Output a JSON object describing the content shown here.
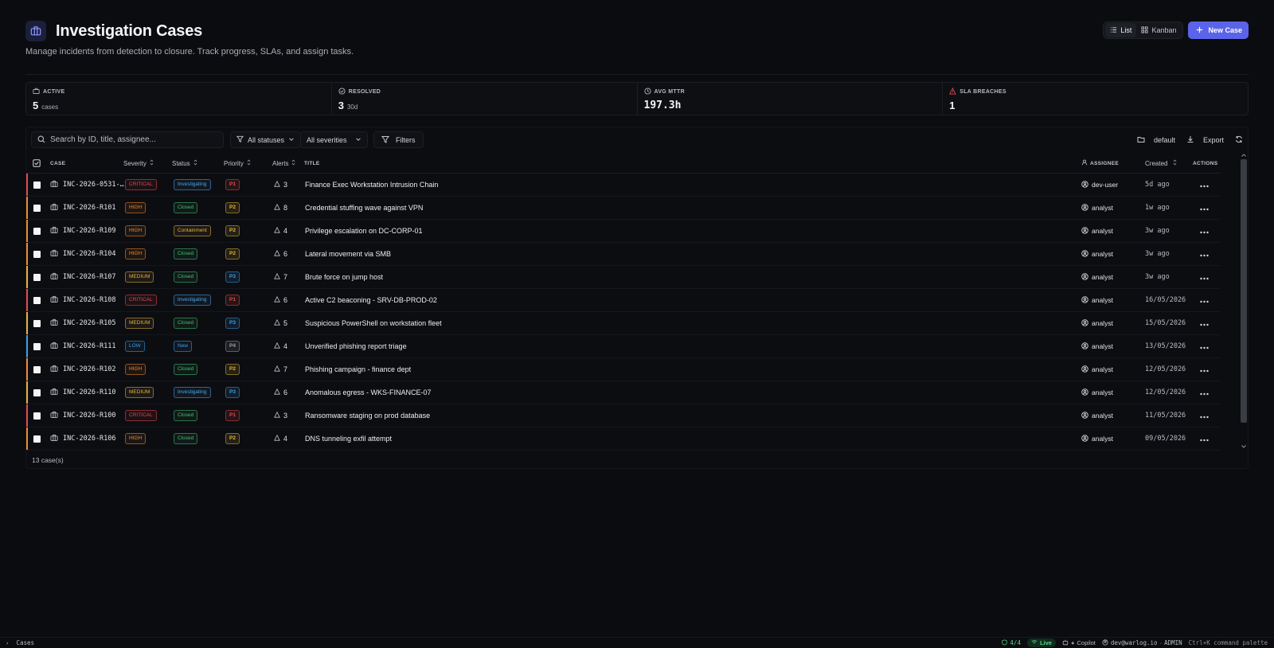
{
  "header": {
    "title": "Investigation Cases",
    "subtitle": "Manage incidents from detection to closure. Track progress, SLAs, and assign tasks.",
    "view_list": "List",
    "view_kanban": "Kanban",
    "new_case": "New Case"
  },
  "stats": [
    {
      "label": "ACTIVE",
      "value": "5",
      "unit": "cases"
    },
    {
      "label": "RESOLVED",
      "value": "3",
      "unit": "30d"
    },
    {
      "label": "AVG MTTR",
      "value": "197.3h",
      "unit": ""
    },
    {
      "label": "SLA BREACHES",
      "value": "1",
      "unit": ""
    }
  ],
  "toolbar": {
    "search_placeholder": "Search by ID, title, assignee...",
    "status_filter": "All statuses",
    "severity_filter": "All severities",
    "filters": "Filters",
    "saved_view": "default",
    "export": "Export"
  },
  "columns": {
    "case": "CASE",
    "severity": "Severity",
    "status": "Status",
    "priority": "Priority",
    "alerts": "Alerts",
    "title": "TITLE",
    "assignee": "ASSIGNEE",
    "created": "Created",
    "actions": "ACTIONS"
  },
  "colors": {
    "critical": "#e5484d",
    "high": "#f0892b",
    "medium": "#e2b33c",
    "low": "#3b9eea",
    "investigating": "#4aa3e8",
    "closed": "#3fbf6f",
    "containment": "#e2b33c",
    "new": "#3b9eea",
    "accent": "#5b64e8"
  },
  "rows": [
    {
      "id": "INC-2026-0531-…",
      "severity": "CRITICAL",
      "status": "Investigating",
      "priority": "P1",
      "alerts": "3",
      "title": "Finance Exec Workstation Intrusion Chain",
      "assignee": "dev-user",
      "created": "5d ago"
    },
    {
      "id": "INC-2026-R101",
      "severity": "HIGH",
      "status": "Closed",
      "priority": "P2",
      "alerts": "8",
      "title": "Credential stuffing wave against VPN",
      "assignee": "analyst",
      "created": "1w ago"
    },
    {
      "id": "INC-2026-R109",
      "severity": "HIGH",
      "status": "Containment",
      "priority": "P2",
      "alerts": "4",
      "title": "Privilege escalation on DC-CORP-01",
      "assignee": "analyst",
      "created": "3w ago"
    },
    {
      "id": "INC-2026-R104",
      "severity": "HIGH",
      "status": "Closed",
      "priority": "P2",
      "alerts": "6",
      "title": "Lateral movement via SMB",
      "assignee": "analyst",
      "created": "3w ago"
    },
    {
      "id": "INC-2026-R107",
      "severity": "MEDIUM",
      "status": "Closed",
      "priority": "P3",
      "alerts": "7",
      "title": "Brute force on jump host",
      "assignee": "analyst",
      "created": "3w ago"
    },
    {
      "id": "INC-2026-R108",
      "severity": "CRITICAL",
      "status": "Investigating",
      "priority": "P1",
      "alerts": "6",
      "title": "Active C2 beaconing - SRV-DB-PROD-02",
      "assignee": "analyst",
      "created": "16/05/2026"
    },
    {
      "id": "INC-2026-R105",
      "severity": "MEDIUM",
      "status": "Closed",
      "priority": "P3",
      "alerts": "5",
      "title": "Suspicious PowerShell on workstation fleet",
      "assignee": "analyst",
      "created": "15/05/2026"
    },
    {
      "id": "INC-2026-R111",
      "severity": "LOW",
      "status": "New",
      "priority": "P4",
      "alerts": "4",
      "title": "Unverified phishing report triage",
      "assignee": "analyst",
      "created": "13/05/2026"
    },
    {
      "id": "INC-2026-R102",
      "severity": "HIGH",
      "status": "Closed",
      "priority": "P2",
      "alerts": "7",
      "title": "Phishing campaign - finance dept",
      "assignee": "analyst",
      "created": "12/05/2026"
    },
    {
      "id": "INC-2026-R110",
      "severity": "MEDIUM",
      "status": "Investigating",
      "priority": "P3",
      "alerts": "6",
      "title": "Anomalous egress - WKS-FINANCE-07",
      "assignee": "analyst",
      "created": "12/05/2026"
    },
    {
      "id": "INC-2026-R100",
      "severity": "CRITICAL",
      "status": "Closed",
      "priority": "P1",
      "alerts": "3",
      "title": "Ransomware staging on prod database",
      "assignee": "analyst",
      "created": "11/05/2026"
    },
    {
      "id": "INC-2026-R106",
      "severity": "HIGH",
      "status": "Closed",
      "priority": "P2",
      "alerts": "4",
      "title": "DNS tunneling exfil attempt",
      "assignee": "analyst",
      "created": "09/05/2026"
    }
  ],
  "footer": {
    "count": "13 case(s)"
  },
  "statusbar": {
    "breadcrumb": "Cases",
    "health": "4/4",
    "live": "Live",
    "copilot": "Copilot",
    "user": "dev@warlog.io",
    "role": "ADMIN",
    "shortcut": "Ctrl+K command palette"
  }
}
